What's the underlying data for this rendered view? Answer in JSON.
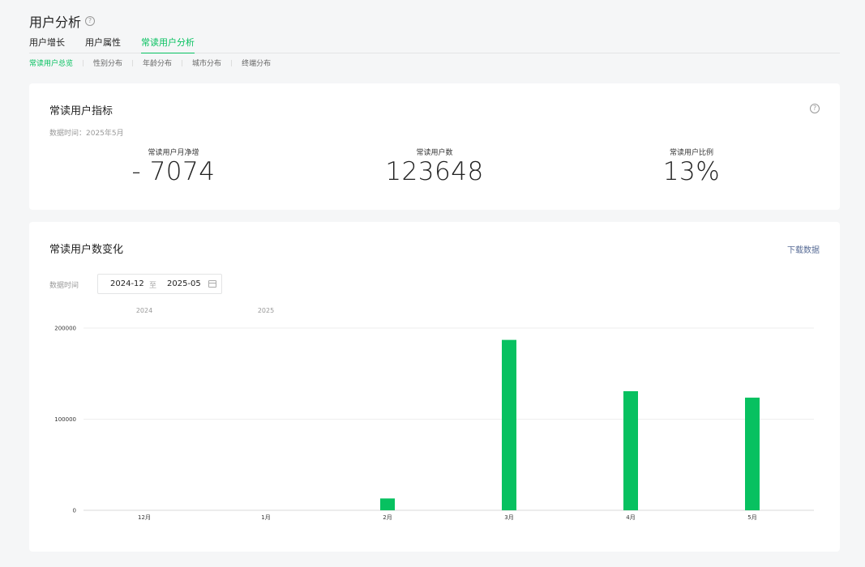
{
  "page": {
    "title": "用户分析",
    "tabs": [
      "用户增长",
      "用户属性",
      "常读用户分析"
    ],
    "sub_tabs": [
      "常读用户总览",
      "性别分布",
      "年龄分布",
      "城市分布",
      "终端分布"
    ]
  },
  "metrics_card": {
    "title": "常读用户指标",
    "data_time": "数据时间：2025年5月",
    "metrics": [
      {
        "label": "常读用户月净增",
        "value": "- 7074"
      },
      {
        "label": "常读用户数",
        "value": "123648"
      },
      {
        "label": "常读用户比例",
        "value": "13%"
      }
    ]
  },
  "trend_card": {
    "title": "常读用户数变化",
    "download": "下载数据",
    "range_label": "数据时间",
    "range_start": "2024-12",
    "range_to": "至",
    "range_end": "2025-05"
  },
  "colors": {
    "accent": "#07c160",
    "link": "#576b95"
  },
  "chart_data": {
    "type": "bar",
    "years": [
      {
        "label": "2024",
        "month_index": 0
      },
      {
        "label": "2025",
        "month_index": 1
      }
    ],
    "categories": [
      "12月",
      "1月",
      "2月",
      "3月",
      "4月",
      "5月"
    ],
    "values": [
      0,
      0,
      13000,
      187000,
      130722,
      123648
    ],
    "ylim": [
      0,
      200000
    ],
    "yticks": [
      "0",
      "100000",
      "200000"
    ],
    "grid": true,
    "color": "#07c160"
  }
}
